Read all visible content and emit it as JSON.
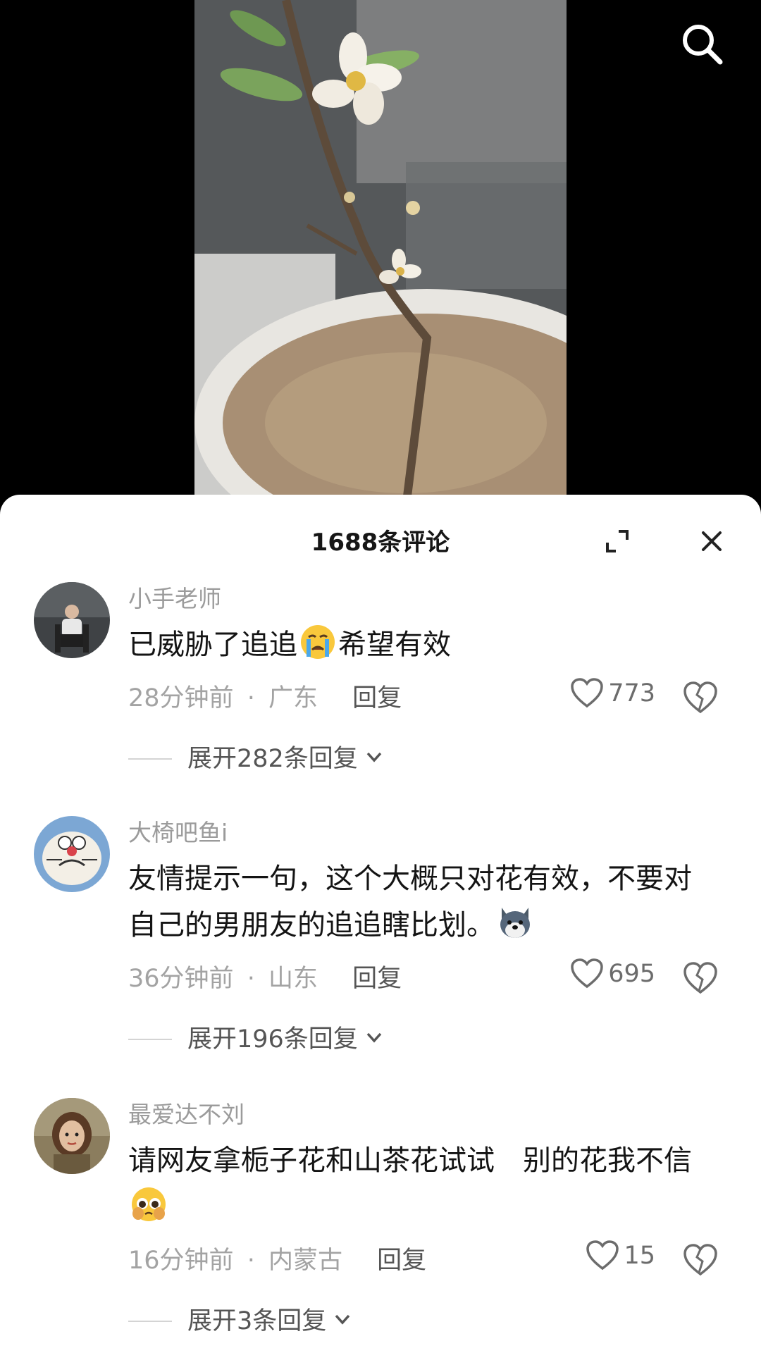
{
  "header": {
    "title": "1688条评论"
  },
  "comments": [
    {
      "username": "小手老师",
      "text_before": "已威胁了追追",
      "emoji": "crying-face-emoji",
      "text_after": "希望有效",
      "time": "28分钟前",
      "location": "广东",
      "reply_label": "回复",
      "likes": "773",
      "expand_label": "展开282条回复"
    },
    {
      "username": "大椅吧鱼i",
      "text_before": "友情提示一句，这个大概只对花有效，不要对自己的男朋友的追追瞎比划。",
      "emoji": "husky-dog-emoji",
      "text_after": "",
      "time": "36分钟前",
      "location": "山东",
      "reply_label": "回复",
      "likes": "695",
      "expand_label": "展开196条回复"
    },
    {
      "username": "最爱达不刘",
      "text_before": "请网友拿栀子花和山茶花试试　别的花我不信",
      "emoji": "pleading-face-emoji",
      "text_after": "",
      "time": "16分钟前",
      "location": "内蒙古",
      "reply_label": "回复",
      "likes": "15",
      "expand_label": "展开3条回复"
    }
  ],
  "meta_separator": "·",
  "colors": {
    "accent_text": "#141414",
    "muted": "#9b9b9b",
    "sheet_bg": "#ffffff"
  }
}
